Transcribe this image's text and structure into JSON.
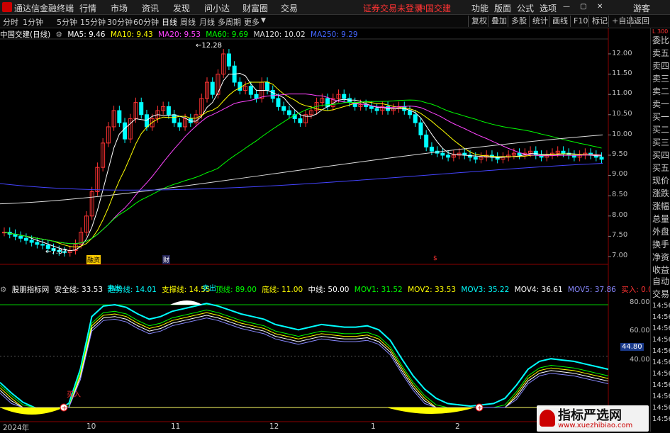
{
  "menubar": {
    "app_name": "通达信金融终端",
    "menus": [
      "行情",
      "市场",
      "资讯",
      "发现",
      "问小达",
      "财富圈",
      "交易"
    ],
    "notice": "证券交易未登录",
    "stock": "中国交建",
    "right": [
      "功能",
      "版面",
      "公式",
      "选项"
    ],
    "guest": "游客"
  },
  "toolbar": {
    "periods": [
      "分时",
      "1分钟",
      "5分钟",
      "15分钟",
      "30分钟",
      "60分钟",
      "日线",
      "周线",
      "月线",
      "多周期",
      "更多"
    ],
    "active": "日线",
    "right_buttons": [
      "复权",
      "叠加",
      "多股",
      "统计",
      "画线",
      "F10",
      "标记",
      "+自选",
      "返回"
    ]
  },
  "ma_legend": {
    "title": "中国交建(日线)",
    "items": [
      {
        "label": "MA5: 9.46",
        "color": "#ffffff"
      },
      {
        "label": "MA10: 9.43",
        "color": "#ffff00"
      },
      {
        "label": "MA20: 9.53",
        "color": "#ff44ff"
      },
      {
        "label": "MA60: 9.69",
        "color": "#00ff00"
      },
      {
        "label": "MA120: 10.02",
        "color": "#dddddd"
      },
      {
        "label": "MA250: 9.29",
        "color": "#4444ff"
      }
    ]
  },
  "price_axis": [
    "12.00",
    "11.50",
    "11.00",
    "10.50",
    "10.00",
    "9.50",
    "9.00",
    "8.50",
    "8.00",
    "7.50",
    "7.00"
  ],
  "price_annotations": {
    "high": "12.28",
    "low": "7.07"
  },
  "event_markers": [
    "融资",
    "财",
    "$"
  ],
  "indicator_legend": {
    "title": "股朋指标网",
    "items": [
      {
        "label": "安全线: 33.53",
        "color": "#ffffff"
      },
      {
        "label": "趋势线: 14.01",
        "color": "#00ffff"
      },
      {
        "label": "支撑线: 14.55",
        "color": "#ffff00"
      },
      {
        "label": "顶线: 89.00",
        "color": "#00ff00"
      },
      {
        "label": "底线: 11.00",
        "color": "#ffff00"
      },
      {
        "label": "中线: 50.00",
        "color": "#ffffff"
      },
      {
        "label": "MOV1: 31.52",
        "color": "#00ff00"
      },
      {
        "label": "MOV2: 33.53",
        "color": "#ffff00"
      },
      {
        "label": "MOV3: 35.22",
        "color": "#00ffff"
      },
      {
        "label": "MOV4: 36.61",
        "color": "#ffffff"
      },
      {
        "label": "MOV5: 37.86",
        "color": "#8888ff"
      },
      {
        "label": "买入: 0.00",
        "color": "#ff3333"
      }
    ]
  },
  "indicator_axis": [
    "80.00",
    "60.00",
    "40.00"
  ],
  "indicator_current": "44.80",
  "signal_labels": {
    "sell": "卖出",
    "buy": "买入"
  },
  "x_axis": [
    "2024年",
    "10",
    "11",
    "12",
    "1",
    "2"
  ],
  "right_panel": {
    "top_code": "L 300",
    "quote_items": [
      "委比",
      "卖五",
      "卖四",
      "卖三",
      "卖二",
      "卖一",
      "买一",
      "买二",
      "买三",
      "买四",
      "买五",
      "现价",
      "涨跌",
      "涨幅",
      "总量",
      "外盘",
      "换手",
      "净资",
      "收益"
    ],
    "lower_items": [
      "自动",
      "交易"
    ],
    "times": [
      "14:56",
      "14:56",
      "14:56",
      "14:56",
      "14:56",
      "14:56",
      "14:56",
      "14:56",
      "14:56",
      "14:56",
      "14:56"
    ]
  },
  "watermark": {
    "title": "指标严选网",
    "url": "www.xuezhibiao.com"
  },
  "colors": {
    "up": "#ff3333",
    "down": "#00ffff",
    "ma5": "#ffffff",
    "ma10": "#ffff00",
    "ma20": "#ff44ff",
    "ma60": "#00ff00",
    "ma120": "#dddddd",
    "ma250": "#4444ff"
  }
}
